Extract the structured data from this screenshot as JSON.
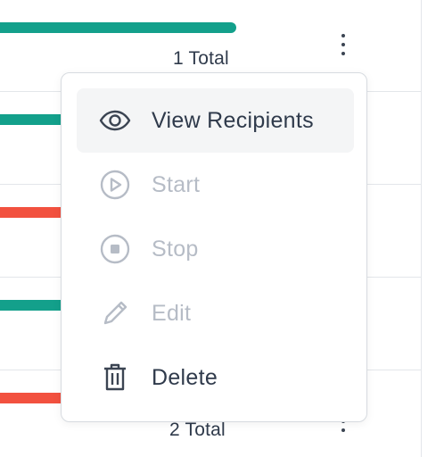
{
  "rows": [
    {
      "status": "success",
      "total_label": "1 Total"
    },
    {
      "status": "success"
    },
    {
      "status": "failed"
    },
    {
      "status": "success"
    },
    {
      "status": "failed",
      "total_label": "2 Total"
    }
  ],
  "colors": {
    "success": "#13a08b",
    "failed": "#f2513f",
    "text": "#2f3a4b",
    "disabled": "#b6bcc6",
    "highlight": "#f4f5f6",
    "border": "#d7dbe0"
  },
  "menu": {
    "items": [
      {
        "label": "View Recipients",
        "icon": "eye-icon",
        "state": "active"
      },
      {
        "label": "Start",
        "icon": "play-circle-icon",
        "state": "disabled"
      },
      {
        "label": "Stop",
        "icon": "stop-circle-icon",
        "state": "disabled"
      },
      {
        "label": "Edit",
        "icon": "pencil-icon",
        "state": "disabled"
      },
      {
        "label": "Delete",
        "icon": "trash-icon",
        "state": "normal"
      }
    ]
  }
}
